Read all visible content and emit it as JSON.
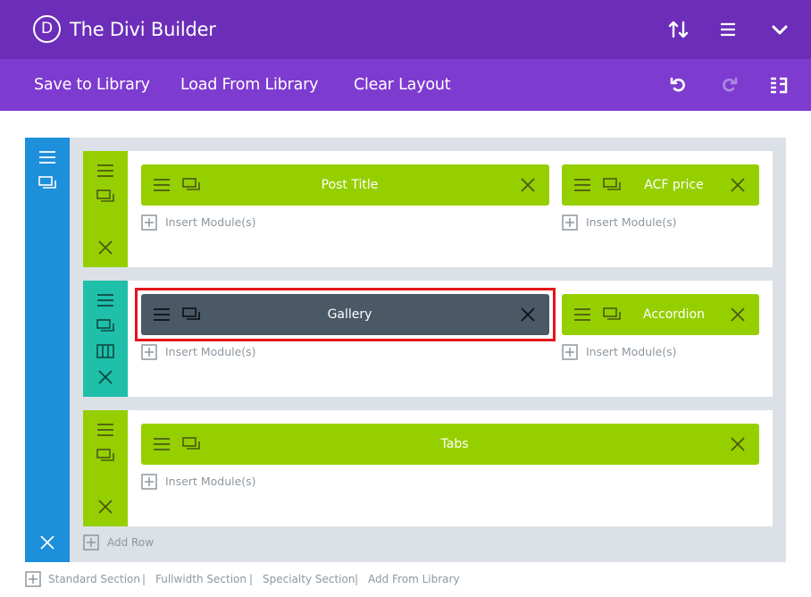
{
  "header": {
    "logo_letter": "D",
    "title": "The Divi Builder",
    "icons": [
      "arrows-up-down-icon",
      "hamburger-menu-icon",
      "chevron-down-icon"
    ]
  },
  "toolbar": {
    "save_label": "Save to Library",
    "load_label": "Load From Library",
    "clear_label": "Clear Layout",
    "icons": [
      "undo-icon",
      "redo-icon",
      "portability-icon"
    ]
  },
  "rows": [
    {
      "columns": [
        {
          "module": {
            "label": "Post Title",
            "state": "normal"
          },
          "insert_label": "Insert Module(s)"
        },
        {
          "module": {
            "label": "ACF price",
            "state": "normal"
          },
          "insert_label": "Insert Module(s)"
        }
      ]
    },
    {
      "columns": [
        {
          "module": {
            "label": "Gallery",
            "state": "selected"
          },
          "insert_label": "Insert Module(s)"
        },
        {
          "module": {
            "label": "Accordion",
            "state": "normal"
          },
          "insert_label": "Insert Module(s)"
        }
      ]
    },
    {
      "columns": [
        {
          "module": {
            "label": "Tabs",
            "state": "normal"
          },
          "insert_label": "Insert Module(s)"
        }
      ]
    }
  ],
  "add_row_label": "Add Row",
  "footer": {
    "standard": "Standard Section",
    "fullwidth": "Fullwidth Section",
    "specialty": "Specialty Section",
    "add_from_library": "Add From Library",
    "separator": "|"
  },
  "colors": {
    "header": "#6c2eb9",
    "toolbar": "#7e3bd0",
    "section": "#1e8fdb",
    "row_teal": "#1fbfa9",
    "module": "#96cf00",
    "module_selected": "#4b5866",
    "highlight": "#e5141b"
  }
}
